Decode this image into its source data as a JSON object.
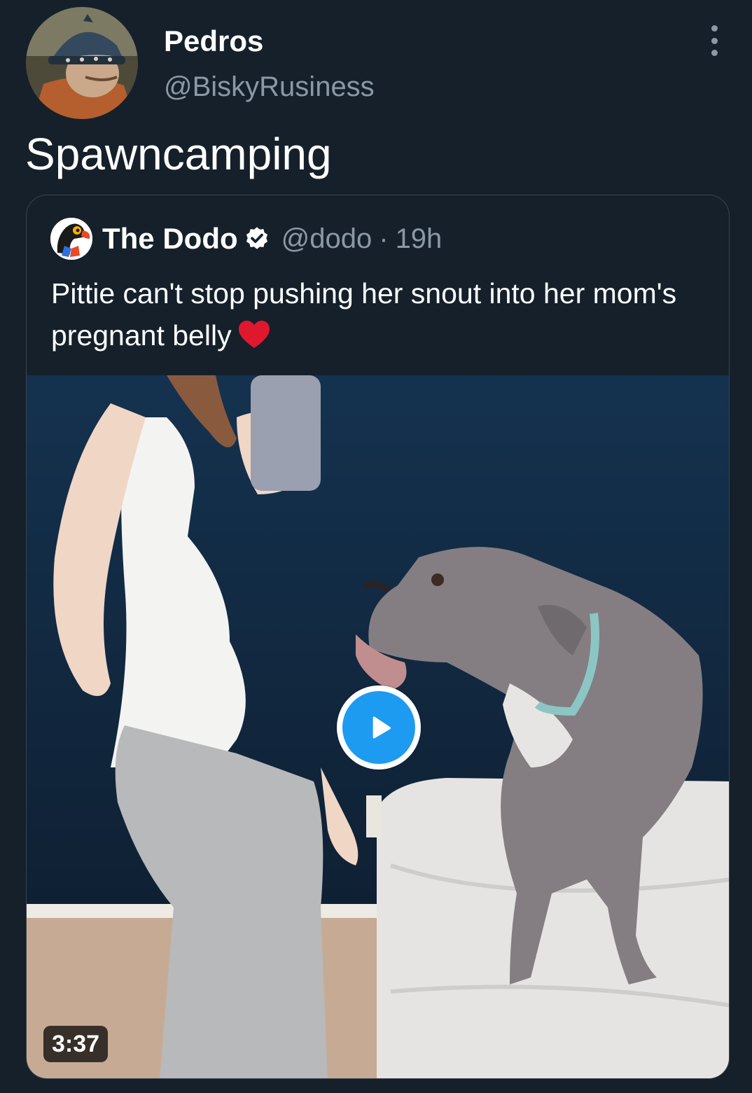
{
  "tweet": {
    "author_name": "Pedros",
    "author_handle": "@BiskyRusiness",
    "text": "Spawncamping",
    "avatar_icon": "knight-helmet-avatar",
    "more_icon": "more-vertical-icon"
  },
  "quoted_tweet": {
    "author_name": "The Dodo",
    "verified_icon": "verified-badge-icon",
    "handle": "@dodo",
    "separator": "·",
    "time": "19h",
    "text": "Pittie can't stop pushing her snout into her mom's pregnant belly",
    "emoji": "red-heart",
    "video": {
      "duration": "3:37",
      "play_icon": "play-icon"
    }
  },
  "colors": {
    "background": "#15202b",
    "secondary_text": "#8b98a5",
    "accent": "#1d9bf0",
    "border": "#38444d",
    "heart": "#e0182d"
  }
}
